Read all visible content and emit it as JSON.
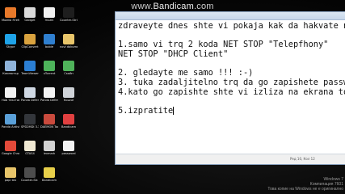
{
  "watermark": {
    "prefix": "www.",
    "brand": "Bandicam",
    "suffix": ".com"
  },
  "desktop_icons": [
    {
      "label": "Mozilla Firefox",
      "color": "#e8792a",
      "col": 0,
      "row": 0
    },
    {
      "label": "Skype",
      "color": "#1fa3e8",
      "col": 0,
      "row": 1
    },
    {
      "label": "Компютър",
      "color": "#8fb3d9",
      "col": 0,
      "row": 2
    },
    {
      "label": "Нов текстов документ",
      "color": "#f3f3f3",
      "col": 0,
      "row": 3
    },
    {
      "label": "Panda Antivirus Pro",
      "color": "#5aa0d8",
      "col": 0,
      "row": 4
    },
    {
      "label": "Google Chrome",
      "color": "#e34a3a",
      "col": 0,
      "row": 5
    },
    {
      "label": "papi tex",
      "color": "#e8c56a",
      "col": 0,
      "row": 6
    },
    {
      "label": "Gadget",
      "color": "#d9d9d9",
      "col": 1,
      "row": 0
    },
    {
      "label": "ClipConvert",
      "color": "#d9a23e",
      "col": 1,
      "row": 1
    },
    {
      "label": "TeamViewer",
      "color": "#2b7fd4",
      "col": 1,
      "row": 2
    },
    {
      "label": "Panda Defense",
      "color": "#cfd8e3",
      "col": 1,
      "row": 3
    },
    {
      "label": "SPD2MDI 3.3 .",
      "color": "#33363b",
      "col": 1,
      "row": 4
    },
    {
      "label": "GTAS4",
      "color": "#efe8d2",
      "col": 1,
      "row": 5
    },
    {
      "label": "Counter-Str. 1.6",
      "color": "#4d4d4d",
      "col": 1,
      "row": 6
    },
    {
      "label": "muzik",
      "color": "#f1f1f1",
      "col": 2,
      "row": 0
    },
    {
      "label": "bobie",
      "color": "#2f7fcf",
      "col": 2,
      "row": 1
    },
    {
      "label": "uTorrent",
      "color": "#4db35a",
      "col": 2,
      "row": 2
    },
    {
      "label": "Panda Defense",
      "color": "#f3f3f3",
      "col": 2,
      "row": 3
    },
    {
      "label": "DAEMON Tools Ultra",
      "color": "#c94a3d",
      "col": 2,
      "row": 4
    },
    {
      "label": "lexmark",
      "color": "#d2d2d2",
      "col": 2,
      "row": 5
    },
    {
      "label": "Bandicam",
      "color": "#e8d04a",
      "col": 2,
      "row": 6
    },
    {
      "label": "Counter-Strike Source",
      "color": "#1e1e1e",
      "col": 3,
      "row": 0
    },
    {
      "label": "novi dokument",
      "color": "#e8c56a",
      "col": 3,
      "row": 1
    },
    {
      "label": "Скайп",
      "color": "#4fb35a",
      "col": 3,
      "row": 2
    },
    {
      "label": "Кошче",
      "color": "#cfd3d8",
      "col": 3,
      "row": 3
    },
    {
      "label": "Bandicam",
      "color": "#e04040",
      "col": 3,
      "row": 4
    },
    {
      "label": "password",
      "color": "#f3f3f3",
      "col": 3,
      "row": 5
    }
  ],
  "editor": {
    "lines": [
      "zdraveyte dnes shte vi pokaja kak da hakvate n",
      "",
      "1.samo vi trq 2 koda NET STOP \"Telepfhony\"",
      "NET STOP \"DHCP Client\"",
      "",
      "2. gledayte me samo !!! :-)",
      "3. tuka zadaljitelno trq da go zapishete passw",
      "4.kato go zapishte shte vi izliza na ekrana to",
      "",
      "5.izpratite"
    ],
    "status_position": "Ред 10, Кол 12"
  },
  "windows_text": [
    "Windows 7",
    "Компилация 7601",
    "Това копие на Windows не е оригинално"
  ]
}
